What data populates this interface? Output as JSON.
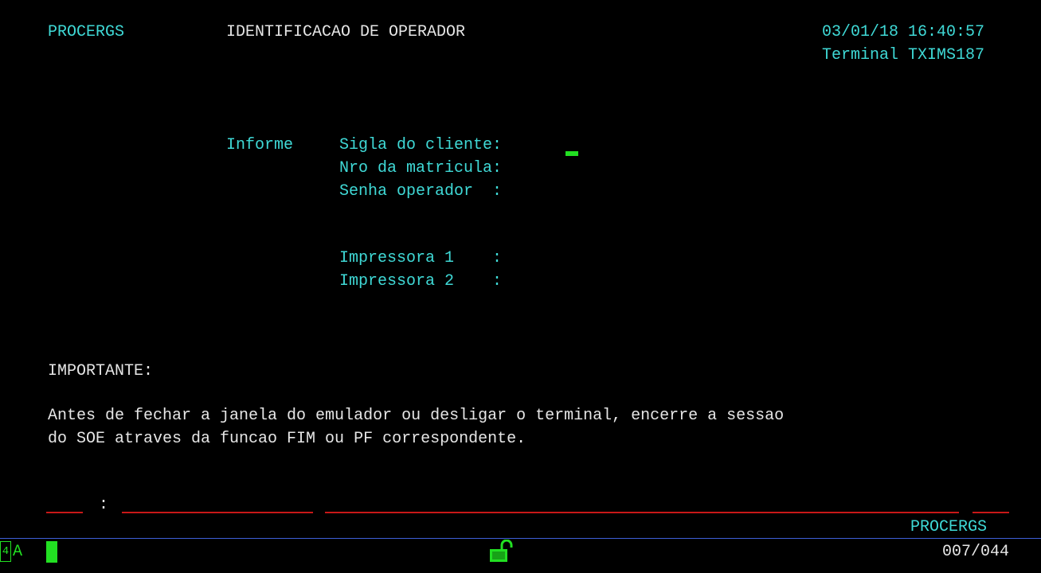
{
  "header": {
    "system": "PROCERGS",
    "title": "IDENTIFICACAO DE OPERADOR",
    "datetime": "03/01/18 16:40:57",
    "terminal": "Terminal TXIMS187"
  },
  "form": {
    "prompt": "Informe",
    "fields": [
      {
        "label": "Sigla do cliente:",
        "value": ""
      },
      {
        "label": "Nro da matricula:",
        "value": ""
      },
      {
        "label": "Senha operador  :",
        "value": ""
      },
      {
        "label": "Impressora 1    :",
        "value": ""
      },
      {
        "label": "Impressora 2    :",
        "value": ""
      }
    ]
  },
  "notice": {
    "heading": "IMPORTANTE:",
    "line1": "Antes de fechar a janela do emulador ou desligar o terminal, encerre a sessao",
    "line2": "do SOE atraves da funcao FIM ou PF correspondente."
  },
  "command_line": {
    "separator": ":"
  },
  "footer": {
    "system": "PROCERGS"
  },
  "oia": {
    "box_glyph": "4",
    "mode": "A",
    "lock_icon": "unlocked-padlock-icon",
    "cursor_position": "007/044"
  },
  "colors": {
    "field_text": "#3fd9d6",
    "static_text": "#e6e6e6",
    "status_green": "#22e022",
    "field_underline": "#c81818",
    "oia_divider": "#3e5fd8"
  }
}
